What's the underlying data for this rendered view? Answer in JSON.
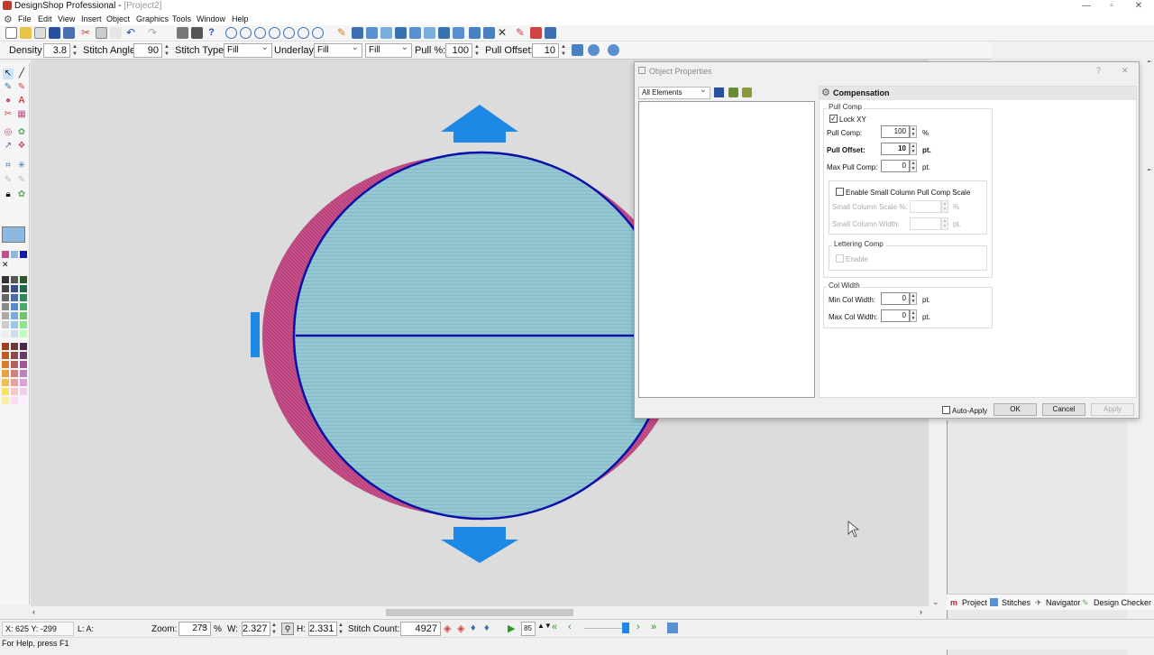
{
  "app": {
    "title": "DesignShop Professional",
    "project": "[Project2]",
    "window_buttons": [
      "—",
      "▫",
      "✕"
    ]
  },
  "menu": [
    "File",
    "Edit",
    "View",
    "Insert",
    "Object",
    "Graphics",
    "Tools",
    "Window",
    "Help"
  ],
  "props_bar": {
    "density_label": "Density",
    "density_value": "3.8",
    "angle_label": "Stitch Angle:",
    "angle_value": "90",
    "type_label": "Stitch Type:",
    "type_value": "Fill",
    "underlay_label": "Underlay:",
    "underlay_value": "Fill",
    "underlay2_value": "Fill",
    "pull_label": "Pull %:",
    "pull_value": "100",
    "offset_label": "Pull Offset:",
    "offset_value": "10"
  },
  "dialog": {
    "title": "Object Properties",
    "help": "?",
    "close": "✕",
    "elements_dropdown": "All Elements",
    "section_title": "Compensation",
    "pull_comp_group": "Pull Comp",
    "lock_xy_label": "Lock XY",
    "lock_xy_checked": true,
    "pull_comp_label": "Pull Comp:",
    "pull_comp_value": "100",
    "pull_comp_unit": "%",
    "pull_offset_label": "Pull Offset:",
    "pull_offset_value": "10",
    "pull_offset_unit": "pt.",
    "max_pull_label": "Max Pull Comp:",
    "max_pull_value": "0",
    "max_pull_unit": "pt.",
    "small_col_label": "Enable Small Column Pull Comp Scale",
    "small_col_scale_label": "Small Column Scale %:",
    "small_col_scale_unit": "%",
    "small_col_width_label": "Small Column Width:",
    "small_col_width_unit": "pt.",
    "lettering_group": "Lettering Comp",
    "lettering_enable": "Enable",
    "col_width_group": "Col Width",
    "min_col_label": "Min Col Width:",
    "min_col_value": "0",
    "min_col_unit": "pt.",
    "max_col_label": "Max Col Width:",
    "max_col_value": "0",
    "max_col_unit": "pt.",
    "auto_apply": "Auto-Apply",
    "ok": "OK",
    "cancel": "Cancel",
    "apply": "Apply"
  },
  "right_tabs": [
    "Project",
    "Stitches",
    "Navigator",
    "Design Checker"
  ],
  "status": {
    "coords": "X: 625  Y: -299",
    "la": "L: A:",
    "zoom_label": "Zoom:",
    "zoom_value": "273",
    "zoom_unit": "%",
    "w_label": "W:",
    "w_value": "2.327",
    "h_label": "H:",
    "h_value": "2.331",
    "stitch_label": "Stitch Count:",
    "stitch_value": "4927",
    "step_value": "85"
  },
  "help_text": "For Help, press F1",
  "colors": {
    "accent": "#1e88e5",
    "outline": "#0a10a8",
    "fill_light": "#9fd3dc",
    "fill_dark": "#7fb4c4",
    "pink": "#c8508a"
  }
}
